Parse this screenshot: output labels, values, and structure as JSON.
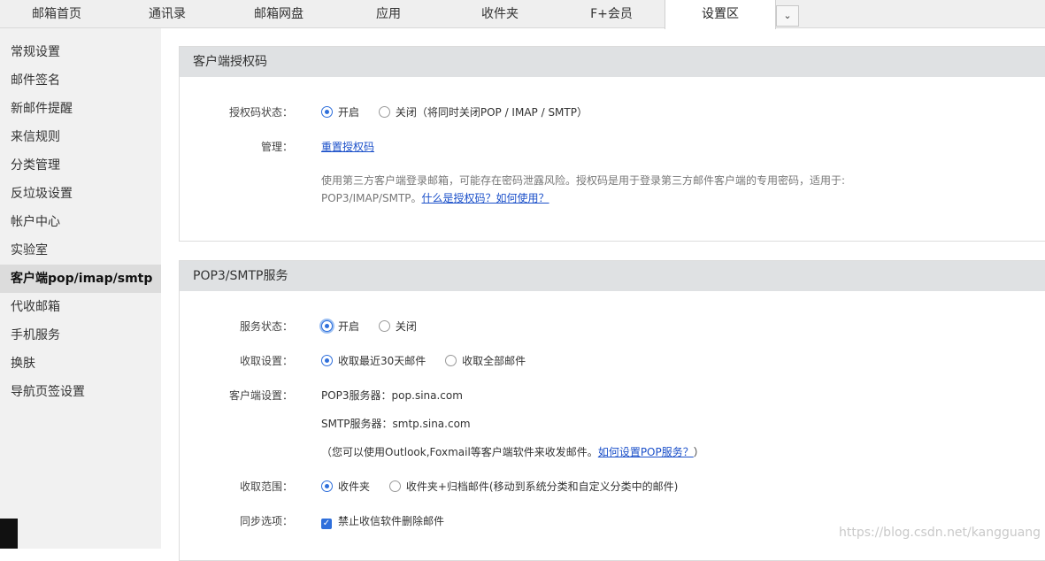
{
  "topnav": {
    "tabs": [
      {
        "label": "邮箱首页"
      },
      {
        "label": "通讯录"
      },
      {
        "label": "邮箱网盘"
      },
      {
        "label": "应用"
      },
      {
        "label": "收件夹"
      },
      {
        "label": "F+会员"
      },
      {
        "label": "设置区",
        "active": true
      }
    ],
    "more_icon": "chevron-down-icon",
    "more_glyph": "⌄"
  },
  "sidebar": {
    "items": [
      {
        "label": "常规设置"
      },
      {
        "label": "邮件签名"
      },
      {
        "label": "新邮件提醒"
      },
      {
        "label": "来信规则"
      },
      {
        "label": "分类管理"
      },
      {
        "label": "反垃圾设置"
      },
      {
        "label": "帐户中心"
      },
      {
        "label": "实验室"
      },
      {
        "label": "客户端pop/imap/smtp",
        "active": true
      },
      {
        "label": "代收邮箱"
      },
      {
        "label": "手机服务"
      },
      {
        "label": "换肤"
      },
      {
        "label": "导航页签设置"
      }
    ]
  },
  "auth_panel": {
    "title": "客户端授权码",
    "status_label": "授权码状态：",
    "status_on": "开启",
    "status_off": "关闭（将同时关闭POP / IMAP / SMTP）",
    "manage_label": "管理：",
    "reset_link": "重置授权码",
    "desc_line1": "使用第三方客户端登录邮箱，可能存在密码泄露风险。授权码是用于登录第三方邮件客户端的专用密码，适用于:",
    "desc_line2": "POP3/IMAP/SMTP。",
    "desc_link": "什么是授权码？如何使用？"
  },
  "pop_panel": {
    "title": "POP3/SMTP服务",
    "service_label": "服务状态：",
    "service_on": "开启",
    "service_off": "关闭",
    "fetch_label": "收取设置：",
    "fetch_30": "收取最近30天邮件",
    "fetch_all": "收取全部邮件",
    "client_label": "客户端设置：",
    "pop3_server": "POP3服务器：pop.sina.com",
    "smtp_server": "SMTP服务器：smtp.sina.com",
    "client_note_pre": "（您可以使用Outlook,Foxmail等客户端软件来收发邮件。",
    "client_note_link": "如何设置POP服务？",
    "client_note_post": "）",
    "range_label": "收取范围：",
    "range_inbox": "收件夹",
    "range_archive": "收件夹+归档邮件(移动到系统分类和自定义分类中的邮件)",
    "sync_label": "同步选项：",
    "sync_option": "禁止收信软件删除邮件"
  },
  "watermark": "https://blog.csdn.net/kangguang",
  "colors": {
    "accent": "#2f6fdb",
    "link": "#1a4fc9",
    "header_bg": "#dfe1e3",
    "sidebar_bg": "#f1f1f1"
  }
}
